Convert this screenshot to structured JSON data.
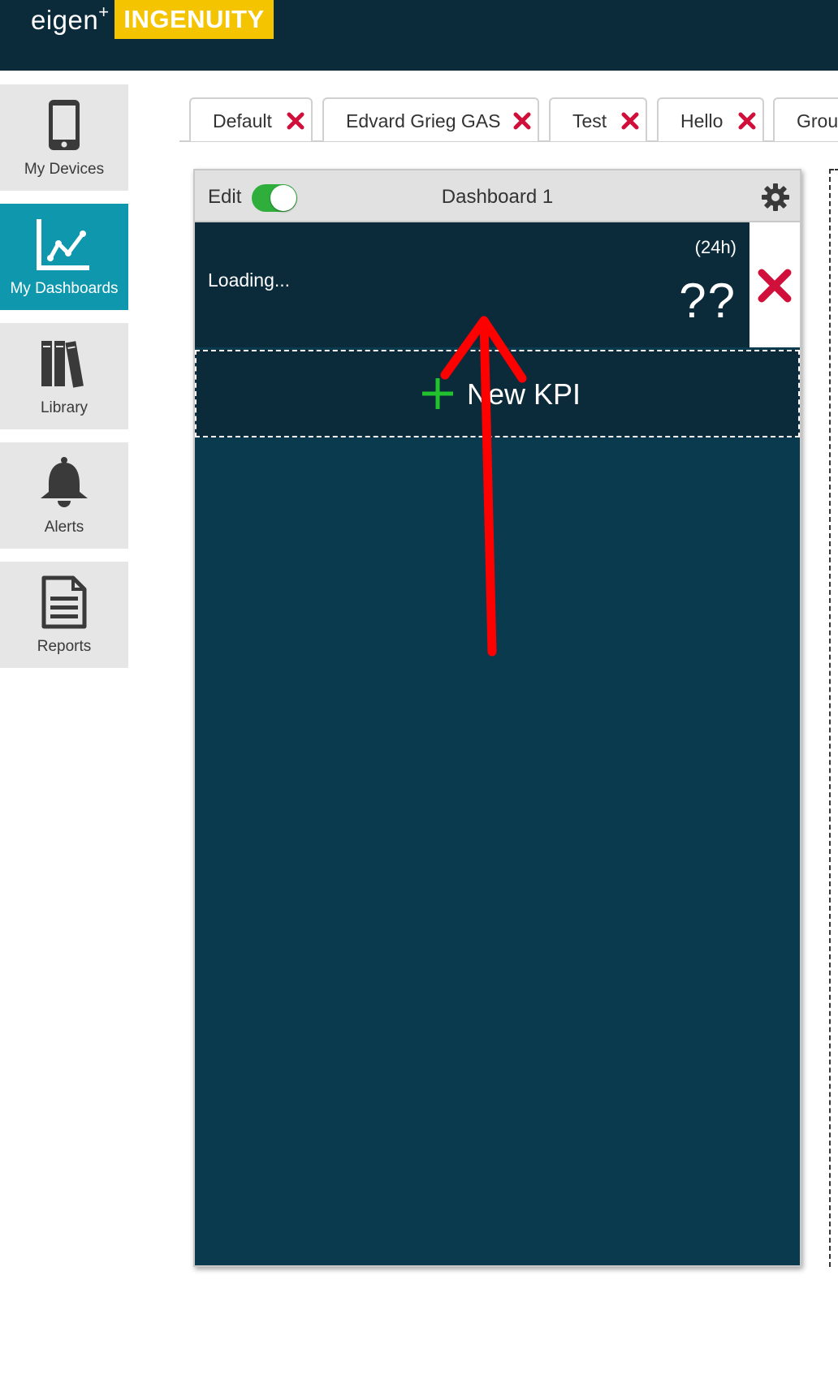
{
  "brand": {
    "eigen": "eigen",
    "plus": "+",
    "product": "INGENUITY"
  },
  "sidebar": {
    "items": [
      {
        "label": "My Devices",
        "icon": "phone-icon",
        "active": false
      },
      {
        "label": "My Dashboards",
        "icon": "line-chart-icon",
        "active": true
      },
      {
        "label": "Library",
        "icon": "books-icon",
        "active": false
      },
      {
        "label": "Alerts",
        "icon": "bell-icon",
        "active": false
      },
      {
        "label": "Reports",
        "icon": "document-icon",
        "active": false
      }
    ]
  },
  "tabs": [
    {
      "label": "Default"
    },
    {
      "label": "Edvard Grieg GAS"
    },
    {
      "label": "Test"
    },
    {
      "label": "Hello"
    },
    {
      "label": "Grou"
    }
  ],
  "dashboard": {
    "edit_label": "Edit",
    "edit_on": true,
    "title": "Dashboard 1",
    "kpi": {
      "status": "Loading...",
      "period": "(24h)",
      "value": "??"
    },
    "new_kpi_label": "New KPI"
  },
  "colors": {
    "topbar": "#0b2a3a",
    "brand_yellow": "#f5c400",
    "active_sidebar": "#0f98ad",
    "panel_bg": "#0a3a4e",
    "close_red": "#d0103a",
    "toggle_green": "#2fae3c",
    "plus_green": "#22c22e",
    "annotation_red": "#ff0000"
  }
}
